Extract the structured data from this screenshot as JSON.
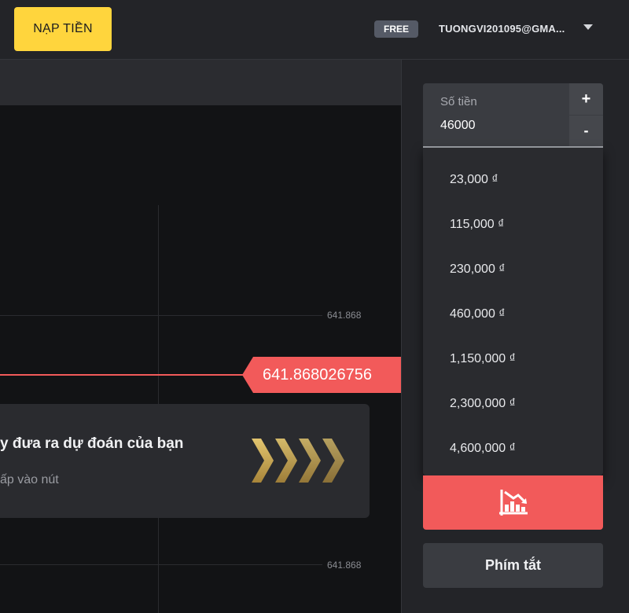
{
  "header": {
    "deposit_label": "NẠP TIỀN",
    "plan_badge": "FREE",
    "account_email": "TUONGVI201095@GMA..."
  },
  "chart": {
    "tick_labels": [
      "641.868",
      "641.868"
    ],
    "current_price": "641.868026756"
  },
  "prompt": {
    "title": "y đưa ra dự đoán của bạn",
    "subtitle": "ấp vào nút"
  },
  "trade_panel": {
    "amount_label": "Số tiền",
    "amount_value": "46000",
    "increment_label": "+",
    "decrement_label": "-",
    "amount_options": [
      "23,000 ₫",
      "115,000 ₫",
      "230,000 ₫",
      "460,000 ₫",
      "1,150,000 ₫",
      "2,300,000 ₫",
      "4,600,000 ₫"
    ],
    "sell_icon": "chart-down-icon",
    "shortcut_label": "Phím tắt"
  },
  "colors": {
    "accent_yellow": "#ffd53d",
    "down_red": "#f25a5a",
    "chevron_gold": "#c9a84f"
  }
}
